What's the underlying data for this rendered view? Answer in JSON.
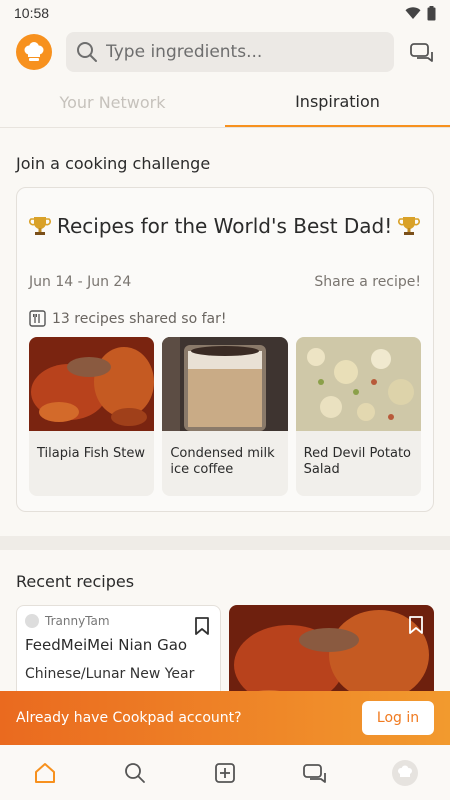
{
  "status": {
    "time": "10:58"
  },
  "header": {
    "search_placeholder": "Type ingredients..."
  },
  "tabs": [
    {
      "label": "Your Network",
      "active": false
    },
    {
      "label": "Inspiration",
      "active": true
    }
  ],
  "challenge": {
    "section_title": "Join a cooking challenge",
    "title": "Recipes for the World's Best Dad!",
    "dates": "Jun 14 - Jun 24",
    "share_label": "Share a recipe!",
    "shared_count": "13 recipes shared so far!",
    "recipes": [
      {
        "name": "Tilapia Fish Stew"
      },
      {
        "name": "Condensed milk ice coffee"
      },
      {
        "name": "Red Devil Potato Salad"
      }
    ]
  },
  "recent": {
    "section_title": "Recent recipes",
    "cards": [
      {
        "author": "TrannyTam",
        "name": "FeedMeiMei Nian Gao",
        "subtitle": "Chinese/Lunar New Year"
      }
    ]
  },
  "login_banner": {
    "text": "Already have Cookpad account?",
    "button": "Log in"
  },
  "colors": {
    "accent": "#f7911e",
    "banner_start": "#ea6a1f",
    "banner_end": "#f29a2e"
  },
  "bottom_nav": [
    "home-icon",
    "search-icon",
    "add-icon",
    "chat-icon",
    "profile-icon"
  ]
}
